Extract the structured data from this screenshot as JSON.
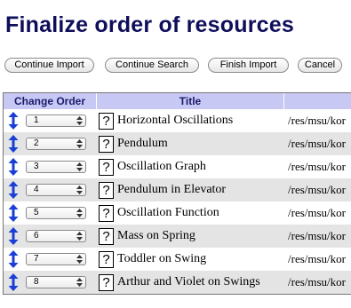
{
  "page": {
    "title": "Finalize order of resources"
  },
  "buttons": {
    "continue_import": "Continue Import",
    "continue_search": "Continue Search",
    "finish_import": "Finish Import",
    "cancel": "Cancel"
  },
  "table": {
    "headers": {
      "order": "Change Order",
      "title": "Title",
      "url": ""
    },
    "rows": [
      {
        "order": "1",
        "help": "?",
        "title": "Horizontal Oscillations",
        "url": "/res/msu/kor"
      },
      {
        "order": "2",
        "help": "?",
        "title": "Pendulum",
        "url": "/res/msu/kor"
      },
      {
        "order": "3",
        "help": "?",
        "title": "Oscillation Graph",
        "url": "/res/msu/kor"
      },
      {
        "order": "4",
        "help": "?",
        "title": "Pendulum in Elevator",
        "url": "/res/msu/kor"
      },
      {
        "order": "5",
        "help": "?",
        "title": "Oscillation Function",
        "url": "/res/msu/kor"
      },
      {
        "order": "6",
        "help": "?",
        "title": "Mass on Spring",
        "url": "/res/msu/kor"
      },
      {
        "order": "7",
        "help": "?",
        "title": "Toddler on Swing",
        "url": "/res/msu/kor"
      },
      {
        "order": "8",
        "help": "?",
        "title": "Arthur and Violet on Swings",
        "url": "/res/msu/kor"
      }
    ]
  },
  "colors": {
    "title": "#0f0e5a",
    "header_bg": "#c8c8f5",
    "arrow": "#1a3fd6",
    "row_alt": "#e4e4e4"
  },
  "icons": {
    "move": "up-down-arrow-icon",
    "help": "help-icon",
    "select": "select-spinner-icon"
  }
}
